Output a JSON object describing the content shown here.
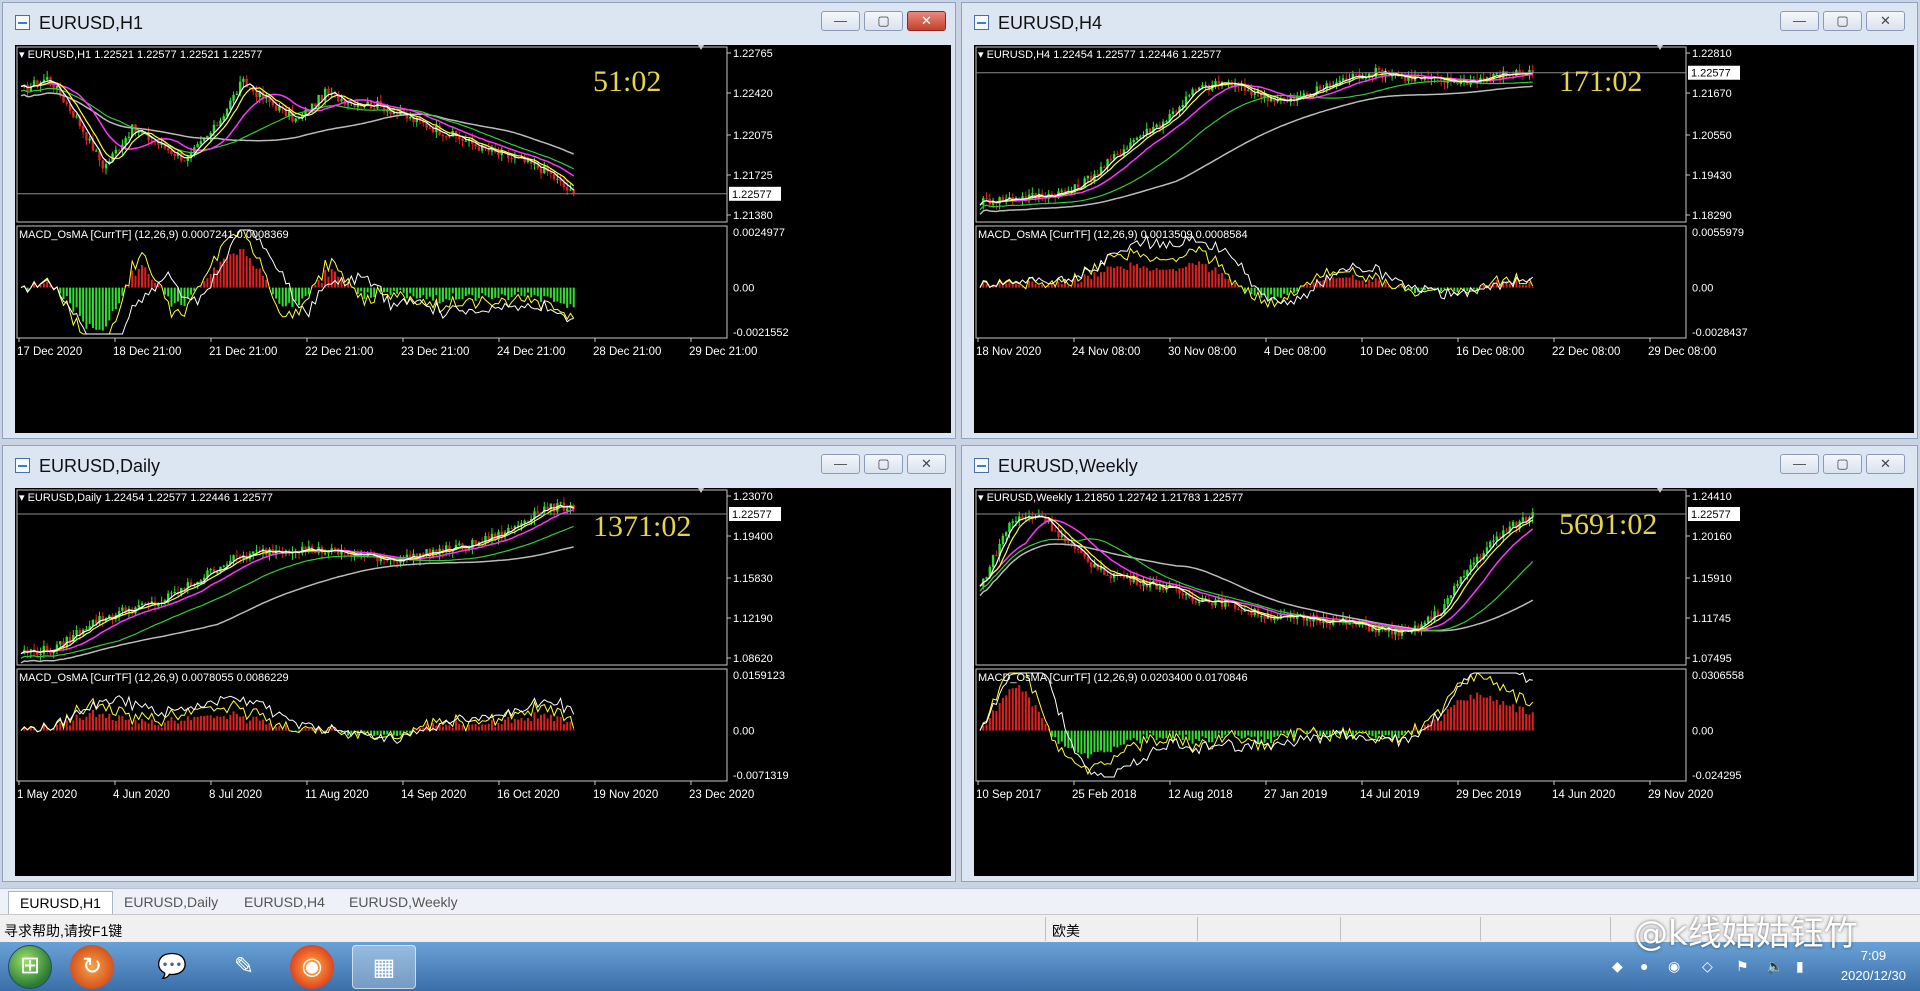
{
  "windows": [
    {
      "title": "EURUSD,H1",
      "info": "EURUSD,H1  1.22521 1.22577 1.22521 1.22577",
      "timer": "51:02",
      "price_ticks": [
        "1.22765",
        "1.22420",
        "1.22075",
        "1.21725",
        "1.21380"
      ],
      "current_price": "1.22577",
      "macd_label": "MACD_OsMA [CurrTF] (12,26,9) 0.0007241 0.0008369",
      "macd_ticks": [
        "0.0024977",
        "0.00",
        "-0.0021552"
      ],
      "time_labels": [
        "17 Dec 2020",
        "18 Dec 21:00",
        "21 Dec 21:00",
        "22 Dec 21:00",
        "23 Dec 21:00",
        "24 Dec 21:00",
        "28 Dec 21:00",
        "29 Dec 21:00"
      ],
      "close_active": true
    },
    {
      "title": "EURUSD,H4",
      "info": "EURUSD,H4  1.22454 1.22577 1.22446 1.22577",
      "timer": "171:02",
      "price_ticks": [
        "1.22810",
        "1.21670",
        "1.20550",
        "1.19430",
        "1.18290"
      ],
      "current_price": "1.22577",
      "macd_label": "MACD_OsMA [CurrTF] (12,26,9) 0.0013509 0.0008584",
      "macd_ticks": [
        "0.0055979",
        "0.00",
        "-0.0028437"
      ],
      "time_labels": [
        "18 Nov 2020",
        "24 Nov 08:00",
        "30 Nov 08:00",
        "4 Dec 08:00",
        "10 Dec 08:00",
        "16 Dec 08:00",
        "22 Dec 08:00",
        "29 Dec 08:00"
      ],
      "close_active": false
    },
    {
      "title": "EURUSD,Daily",
      "info": "EURUSD,Daily  1.22454 1.22577 1.22446 1.22577",
      "timer": "1371:02",
      "price_ticks": [
        "1.23070",
        "1.19400",
        "1.15830",
        "1.12190",
        "1.08620"
      ],
      "current_price": "1.22577",
      "macd_label": "MACD_OsMA [CurrTF] (12,26,9) 0.0078055 0.0086229",
      "macd_ticks": [
        "0.0159123",
        "0.00",
        "-0.0071319"
      ],
      "time_labels": [
        "1 May 2020",
        "4 Jun 2020",
        "8 Jul 2020",
        "11 Aug 2020",
        "14 Sep 2020",
        "16 Oct 2020",
        "19 Nov 2020",
        "23 Dec 2020"
      ],
      "close_active": false
    },
    {
      "title": "EURUSD,Weekly",
      "info": "EURUSD,Weekly  1.21850 1.22742 1.21783 1.22577",
      "timer": "5691:02",
      "price_ticks": [
        "1.24410",
        "1.20160",
        "1.15910",
        "1.11745",
        "1.07495"
      ],
      "current_price": "1.22577",
      "macd_label": "MACD_OsMA [CurrTF] (12,26,9) 0.0203400 0.0170846",
      "macd_ticks": [
        "0.0306558",
        "0.00",
        "-0.024295"
      ],
      "time_labels": [
        "10 Sep 2017",
        "25 Feb 2018",
        "12 Aug 2018",
        "27 Jan 2019",
        "14 Jul 2019",
        "29 Dec 2019",
        "14 Jun 2020",
        "29 Nov 2020"
      ],
      "close_active": false
    }
  ],
  "tabs": [
    "EURUSD,H1",
    "EURUSD,Daily",
    "EURUSD,H4",
    "EURUSD,Weekly"
  ],
  "status": {
    "help": "寻求帮助,请按F1键",
    "region": "欧美"
  },
  "taskbar": {
    "apps": [
      "firefox-like-icon",
      "wechat-icon",
      "notes-icon",
      "firefox-icon",
      "metatrader-icon"
    ],
    "time": "7:09",
    "date": "2020/12/30"
  },
  "watermark": "@k线姑姑钰竹",
  "colors": {
    "background": "#000000",
    "candle_up": "#33dd33",
    "candle_down": "#dd2222",
    "ma_fast": "#ffffff",
    "ma_yellow": "#ffff33",
    "ma_magenta": "#ff33ff",
    "ma_green": "#33cc33",
    "ma_gray": "#bbbbbb",
    "timer": "#e6d44a"
  }
}
